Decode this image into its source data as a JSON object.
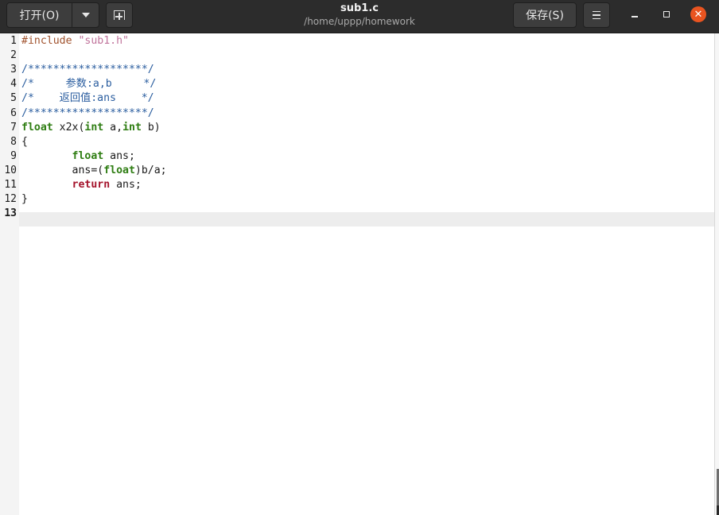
{
  "header": {
    "open_label": "打开(O)",
    "title": "sub1.c",
    "subtitle": "/home/uppp/homework",
    "save_label": "保存(S)"
  },
  "icons": {
    "open_menu": "chevron-down-icon",
    "new_tab": "new-tab-icon",
    "menu": "hamburger-menu-icon",
    "minimize": "minimize-icon",
    "maximize": "maximize-icon",
    "close": "close-icon"
  },
  "colors": {
    "close_button": "#e95420",
    "preprocessor": "#a0522d",
    "string": "#c0739b",
    "comment": "#2a5d9f",
    "type": "#2e7d12",
    "keyword": "#a4122a"
  },
  "editor": {
    "current_line": 13,
    "line_numbers": [
      "1",
      "2",
      "3",
      "4",
      "5",
      "6",
      "7",
      "8",
      "9",
      "10",
      "11",
      "12",
      "13"
    ],
    "lines": [
      {
        "segments": [
          {
            "t": "#include ",
            "c": "pre"
          },
          {
            "t": "\"sub1.h\"",
            "c": "str"
          }
        ]
      },
      {
        "segments": []
      },
      {
        "segments": [
          {
            "t": "/*******************/",
            "c": "com"
          }
        ]
      },
      {
        "segments": [
          {
            "t": "/*     参数:a,b     */",
            "c": "com"
          }
        ]
      },
      {
        "segments": [
          {
            "t": "/*    返回值:ans    */",
            "c": "com"
          }
        ]
      },
      {
        "segments": [
          {
            "t": "/*******************/",
            "c": "com"
          }
        ]
      },
      {
        "segments": [
          {
            "t": "float",
            "c": "type"
          },
          {
            "t": " x2x(",
            "c": ""
          },
          {
            "t": "int",
            "c": "type"
          },
          {
            "t": " a,",
            "c": ""
          },
          {
            "t": "int",
            "c": "type"
          },
          {
            "t": " b)",
            "c": ""
          }
        ]
      },
      {
        "segments": [
          {
            "t": "{",
            "c": ""
          }
        ]
      },
      {
        "segments": [
          {
            "t": "        ",
            "c": ""
          },
          {
            "t": "float",
            "c": "type"
          },
          {
            "t": " ans;",
            "c": ""
          }
        ]
      },
      {
        "segments": [
          {
            "t": "        ans=(",
            "c": ""
          },
          {
            "t": "float",
            "c": "type"
          },
          {
            "t": ")b/a;",
            "c": ""
          }
        ]
      },
      {
        "segments": [
          {
            "t": "        ",
            "c": ""
          },
          {
            "t": "return",
            "c": "kw"
          },
          {
            "t": " ans;",
            "c": ""
          }
        ]
      },
      {
        "segments": [
          {
            "t": "}",
            "c": ""
          }
        ]
      },
      {
        "segments": []
      }
    ]
  }
}
